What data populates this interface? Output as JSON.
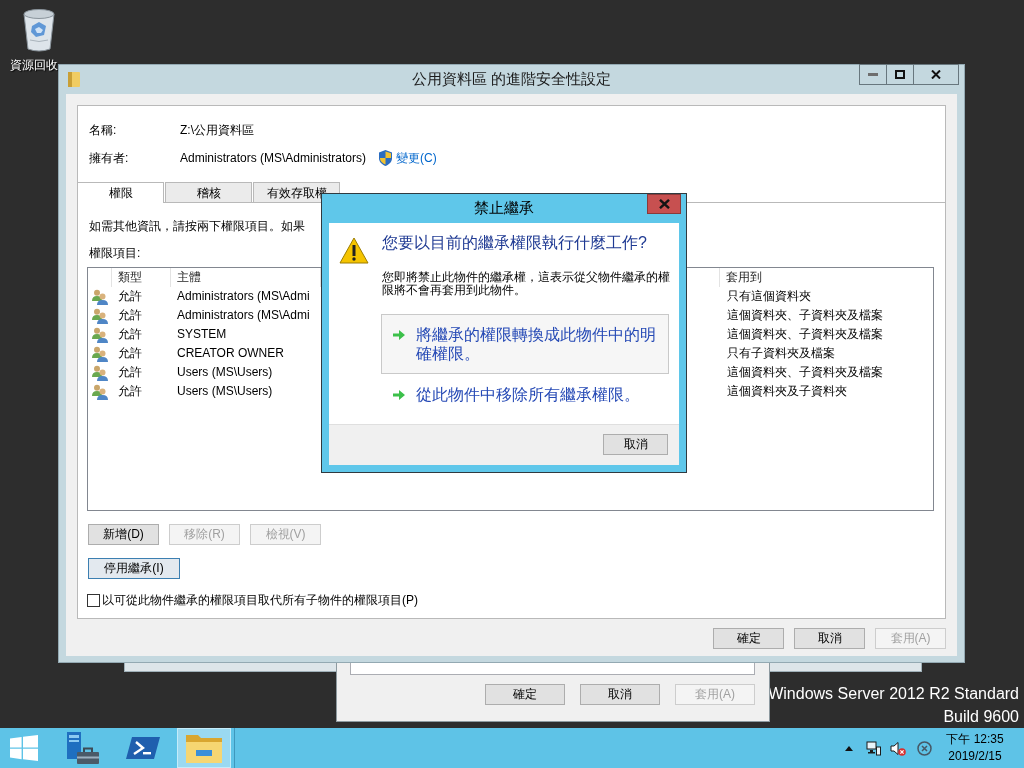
{
  "desktop": {
    "recycle_bin_label": "資源回收",
    "edition": "Windows Server 2012 R2 Standard",
    "build": "Build 9600"
  },
  "background_window": {
    "buttons": [
      {
        "label": "確定",
        "disabled": false
      },
      {
        "label": "取消",
        "disabled": false
      },
      {
        "label": "套用(A)",
        "disabled": true
      }
    ]
  },
  "window": {
    "title": "公用資料區 的進階安全性設定",
    "fields": [
      {
        "label": "名稱:",
        "value": "Z:\\公用資料區"
      },
      {
        "label": "擁有者:",
        "value": "Administrators (MS\\Administrators)",
        "link": "變更(C)"
      }
    ],
    "tabs": [
      {
        "label": "權限",
        "selected": true
      },
      {
        "label": "稽核",
        "selected": false
      },
      {
        "label": "有效存取權",
        "selected": false
      }
    ],
    "info_text": "如需其他資訊，請按兩下權限項目。如果",
    "entries_label": "權限項目:",
    "table": {
      "columns": [
        "類型",
        "主體",
        "套用到"
      ],
      "rows": [
        {
          "type": "允許",
          "principal": "Administrators (MS\\Admi",
          "applies_to": "只有這個資料夾"
        },
        {
          "type": "允許",
          "principal": "Administrators (MS\\Admi",
          "applies_to": "這個資料夾、子資料夾及檔案"
        },
        {
          "type": "允許",
          "principal": "SYSTEM",
          "applies_to": "這個資料夾、子資料夾及檔案"
        },
        {
          "type": "允許",
          "principal": "CREATOR OWNER",
          "applies_to": "只有子資料夾及檔案"
        },
        {
          "type": "允許",
          "principal": "Users (MS\\Users)",
          "applies_to": "這個資料夾、子資料夾及檔案"
        },
        {
          "type": "允許",
          "principal": "Users (MS\\Users)",
          "applies_to": "這個資料夾及子資料夾"
        }
      ]
    },
    "entry_buttons": [
      {
        "label": "新增(D)",
        "disabled": false
      },
      {
        "label": "移除(R)",
        "disabled": true
      },
      {
        "label": "檢視(V)",
        "disabled": true
      }
    ],
    "inheritance_button": {
      "label": "停用繼承(I)",
      "focused": true
    },
    "replace_checkbox": {
      "label": "以可從此物件繼承的權限項目取代所有子物件的權限項目(P)",
      "checked": false
    },
    "buttons": [
      {
        "label": "確定",
        "disabled": false
      },
      {
        "label": "取消",
        "disabled": false
      },
      {
        "label": "套用(A)",
        "disabled": true
      }
    ]
  },
  "dialog": {
    "title": "禁止繼承",
    "heading": "您要以目前的繼承權限執行什麼工作?",
    "description": "您即將禁止此物件的繼承權，這表示從父物件繼承的權限將不會再套用到此物件。",
    "options": [
      {
        "label": "將繼承的權限轉換成此物件中的明確權限。",
        "highlighted": true
      },
      {
        "label": "從此物件中移除所有繼承權限。",
        "highlighted": false
      }
    ],
    "cancel": "取消"
  },
  "taskbar": {
    "apps": [
      {
        "active": false
      },
      {
        "active": false
      },
      {
        "active": true
      }
    ],
    "volume_muted": true,
    "time": "下午 12:35",
    "date": "2019/2/15"
  }
}
